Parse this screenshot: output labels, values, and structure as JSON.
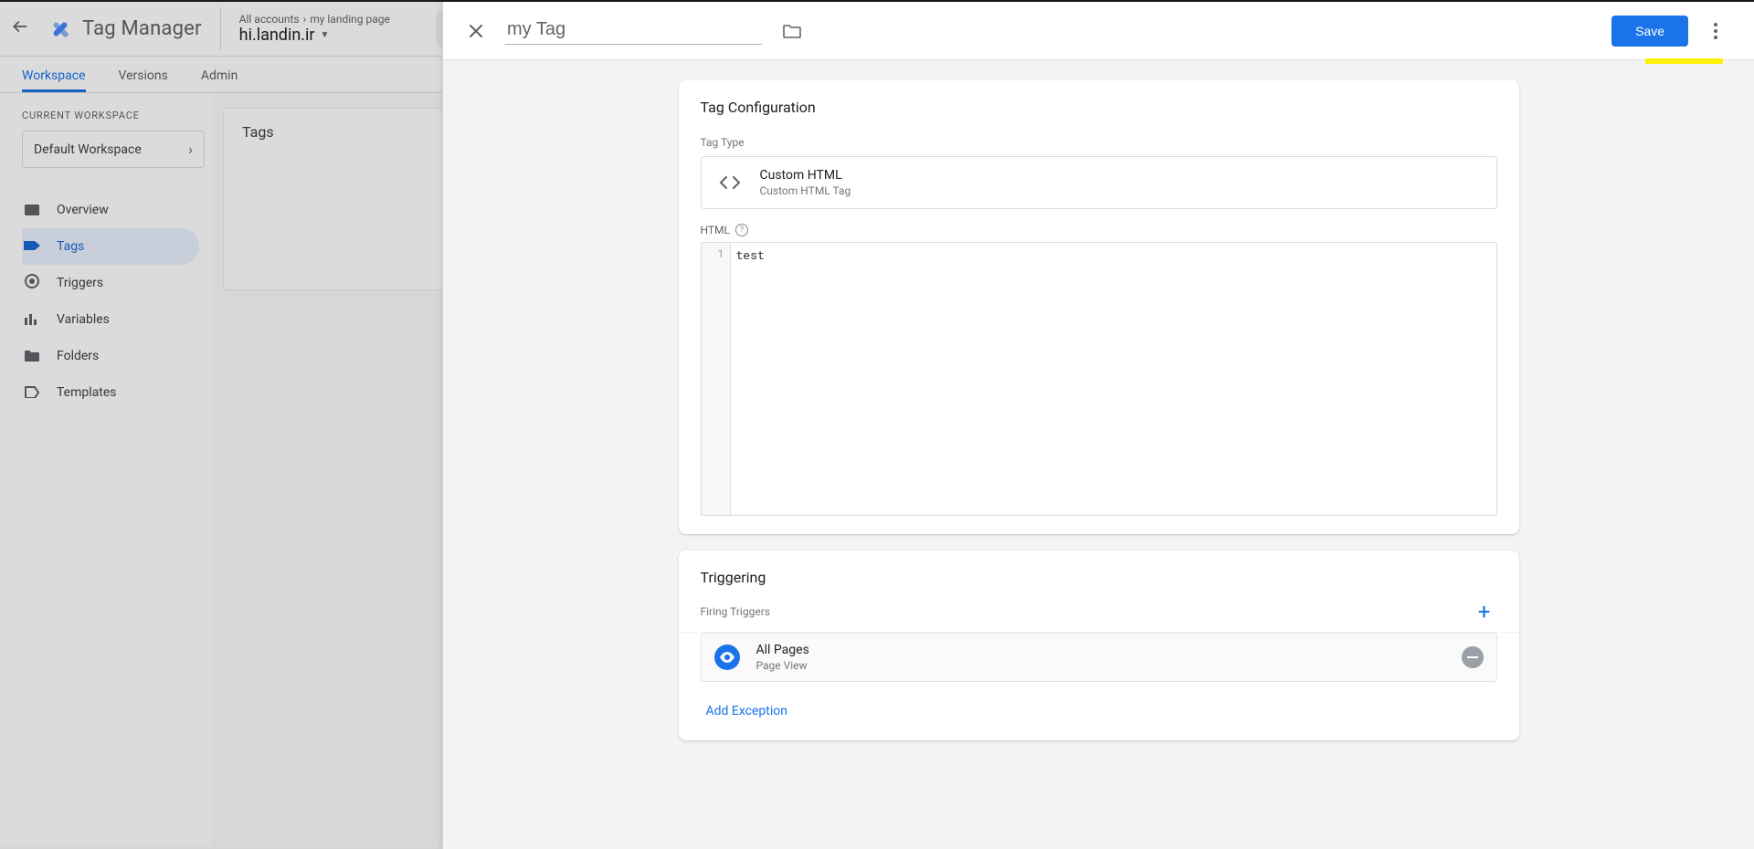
{
  "header": {
    "product": "Tag Manager",
    "breadcrumb": {
      "accounts": "All accounts",
      "account": "my landing page"
    },
    "container": "hi.landin.ir"
  },
  "subnav": {
    "workspace": "Workspace",
    "versions": "Versions",
    "admin": "Admin"
  },
  "sidebar": {
    "current_workspace_label": "CURRENT WORKSPACE",
    "workspace_name": "Default Workspace",
    "items": {
      "overview": "Overview",
      "tags": "Tags",
      "triggers": "Triggers",
      "variables": "Variables",
      "folders": "Folders",
      "templates": "Templates"
    }
  },
  "main": {
    "tags_title": "Tags"
  },
  "editor": {
    "tag_name": "my Tag",
    "save_label": "Save",
    "tag_config": {
      "title": "Tag Configuration",
      "tag_type_label": "Tag Type",
      "type_name": "Custom HTML",
      "type_sub": "Custom HTML Tag",
      "html_label": "HTML",
      "code_lines": [
        "test"
      ]
    },
    "triggering": {
      "title": "Triggering",
      "firing_label": "Firing Triggers",
      "trigger": {
        "name": "All Pages",
        "sub": "Page View"
      },
      "add_exception": "Add Exception"
    }
  }
}
